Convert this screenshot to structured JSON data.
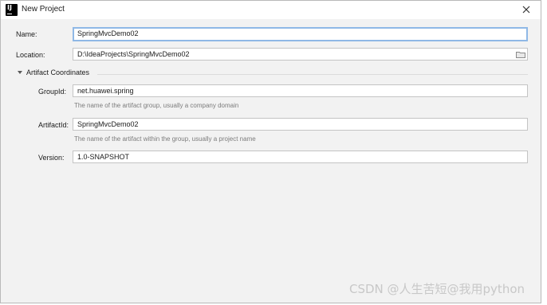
{
  "window": {
    "title": "New Project",
    "app_icon_text": "IJ"
  },
  "form": {
    "name": {
      "label": "Name:",
      "value": "SpringMvcDemo02"
    },
    "location": {
      "label": "Location:",
      "value": "D:\\IdeaProjects\\SpringMvcDemo02"
    },
    "artifact_section": {
      "title": "Artifact Coordinates",
      "expanded": true,
      "group_id": {
        "label": "GroupId:",
        "value": "net.huawei.spring",
        "hint": "The name of the artifact group, usually a company domain"
      },
      "artifact_id": {
        "label": "ArtifactId:",
        "value": "SpringMvcDemo02",
        "hint": "The name of the artifact within the group, usually a project name"
      },
      "version": {
        "label": "Version:",
        "value": "1.0-SNAPSHOT"
      }
    }
  },
  "watermark": "CSDN @人生苦短@我用python",
  "colors": {
    "background": "#f2f2f2",
    "field_focus_border": "#8fb8e6",
    "hint_text": "#7c7c7c"
  },
  "icons": {
    "close": "close-icon",
    "folder": "folder-icon",
    "expand": "triangle-down-icon"
  }
}
